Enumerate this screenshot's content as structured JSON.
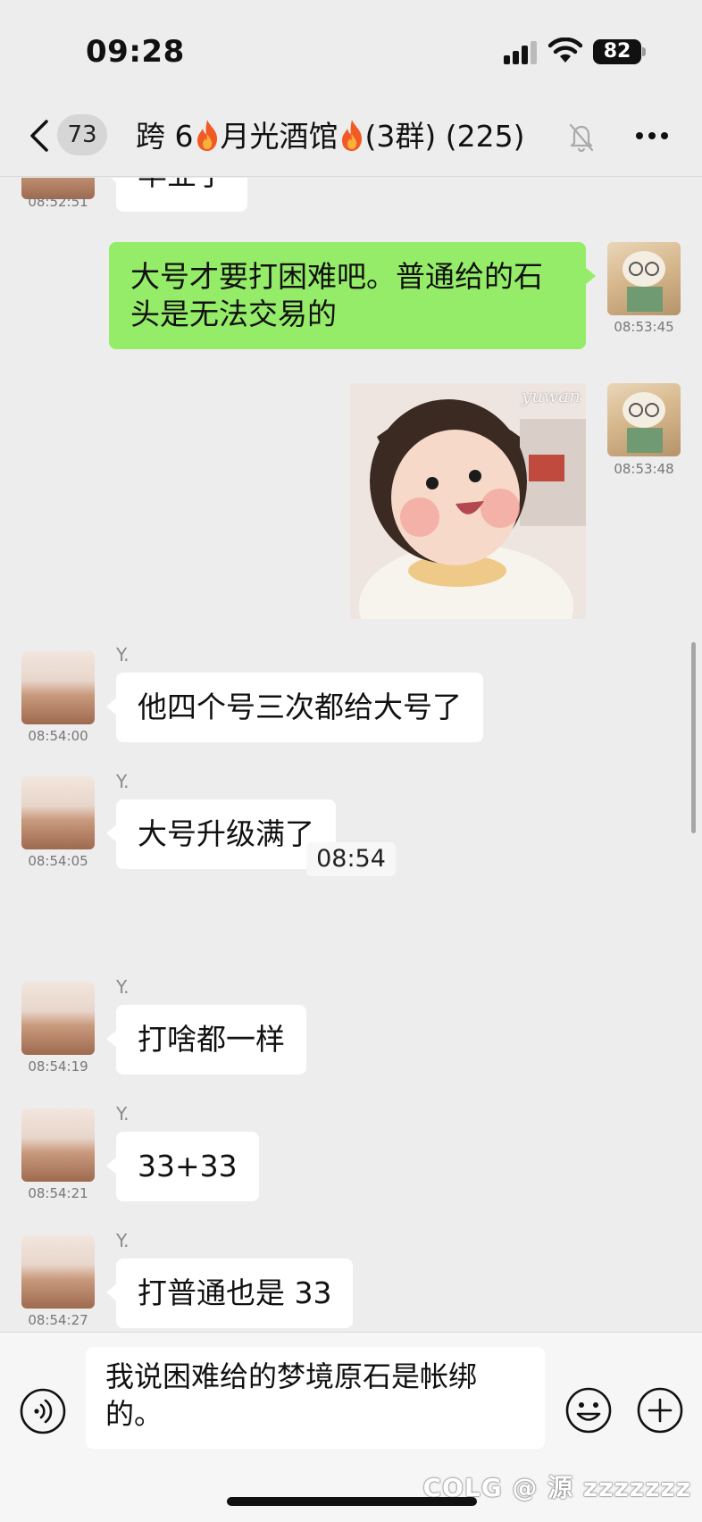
{
  "status_bar": {
    "time": "09:28",
    "battery": "82"
  },
  "nav": {
    "unread_count": "73",
    "title_part1": "跨 6",
    "title_part2": "月光酒馆",
    "title_part3": "(3群) (225)"
  },
  "messages": [
    {
      "partial_text": "毕业了",
      "time": "08:52:51"
    },
    {
      "text_line1": "大号才要打困难吧。普通给的石",
      "text_line2": "头是无法交易的",
      "time": "08:53:45"
    },
    {
      "sticker_watermark": "yuwan",
      "time": "08:53:48"
    },
    {
      "sender": "Y.",
      "text": "他四个号三次都给大号了",
      "time": "08:54:00"
    },
    {
      "sender": "Y.",
      "text": "大号升级满了",
      "time": "08:54:05"
    },
    {
      "sender": "Y.",
      "text": "打啥都一样",
      "time": "08:54:19"
    },
    {
      "sender": "Y.",
      "text": "33+33",
      "time": "08:54:21"
    },
    {
      "sender": "Y.",
      "text": "打普通也是 33",
      "time": "08:54:27"
    }
  ],
  "center_timestamp": "08:54",
  "input": {
    "line1": "我说困难给的梦境原石是帐绑",
    "line2": "的。"
  },
  "watermark": "COLG @ 源 zzzzzzz",
  "colors": {
    "outgoing_bubble": "#95ec69",
    "incoming_bubble": "#ffffff",
    "background": "#ededed"
  }
}
